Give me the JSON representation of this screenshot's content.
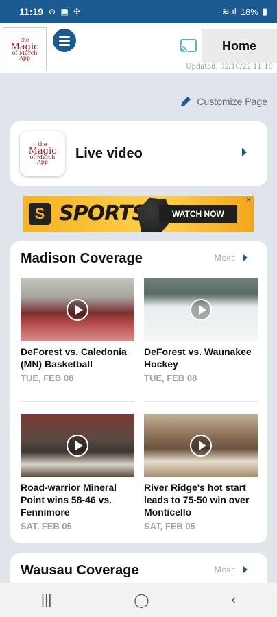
{
  "status_bar": {
    "time": "11:19",
    "battery": "18%"
  },
  "app_bar": {
    "logo_lines": [
      "the",
      "Magic",
      "of March",
      "App"
    ],
    "home_label": "Home",
    "updated": "Updated: 02/10/22 11:19"
  },
  "customize_label": "Customize Page",
  "live": {
    "label": "Live video"
  },
  "ad": {
    "brand": "SPORTS.TV",
    "cta": "WATCH NOW"
  },
  "sections": [
    {
      "title": "Madison Coverage",
      "more_label": "More",
      "items": [
        {
          "title": "DeForest vs. Caledonia (MN) Basketball",
          "date": "TUE, FEB 08"
        },
        {
          "title": "DeForest vs. Waunakee Hockey",
          "date": "TUE, FEB 08"
        },
        {
          "title": "Road-warrior Mineral Point wins 58-46 vs. Fennimore",
          "date": "SAT, FEB 05"
        },
        {
          "title": "River Ridge's hot start leads to 75-50 win over Monticello",
          "date": "SAT, FEB 05"
        }
      ]
    },
    {
      "title": "Wausau Coverage",
      "more_label": "More"
    }
  ],
  "colors": {
    "brand_blue": "#1c5b91",
    "background": "#dfe5ea"
  }
}
